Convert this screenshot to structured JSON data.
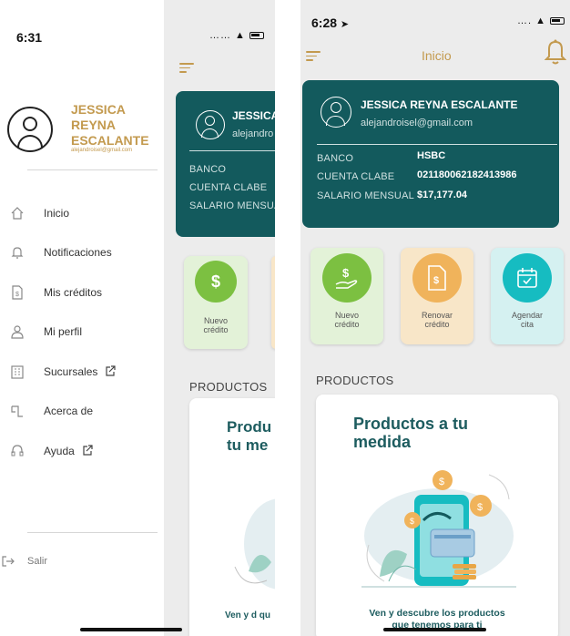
{
  "left": {
    "status": {
      "time": "6:31",
      "icons": "……"
    },
    "drawer": {
      "user_name": "JESSICA REYNA ESCALANTE",
      "user_email": "alejandroisel@gmail.com",
      "menu": [
        {
          "label": "Inicio",
          "icon": "home-icon"
        },
        {
          "label": "Notificaciones",
          "icon": "bell-icon"
        },
        {
          "label": "Mis créditos",
          "icon": "document-icon"
        },
        {
          "label": "Mi perfil",
          "icon": "person-icon"
        },
        {
          "label": "Sucursales",
          "icon": "building-icon"
        },
        {
          "label": "Acerca de",
          "icon": "info-card-icon"
        },
        {
          "label": "Ayuda",
          "icon": "headset-icon"
        }
      ],
      "logout": "Salir"
    },
    "behind": {
      "card_name": "JESSICA",
      "card_email": "alejandro",
      "rows": [
        "BANCO",
        "CUENTA CLABE",
        "SALARIO MENSUA"
      ],
      "action_label": "Nuevo crédito",
      "section": "PRODUCTOS",
      "promo_title": "Produ tu me",
      "promo_sub": "Ven y d qu"
    }
  },
  "right": {
    "status": {
      "time": "6:28"
    },
    "header": {
      "title": "Inicio"
    },
    "card": {
      "name": "JESSICA  REYNA ESCALANTE",
      "email": "alejandroisel@gmail.com",
      "rows": [
        {
          "label": "BANCO",
          "value": "HSBC"
        },
        {
          "label": "CUENTA CLABE",
          "value": "021180062182413986"
        },
        {
          "label": "SALARIO MENSUAL",
          "value": "$17,177.04"
        }
      ]
    },
    "actions": [
      {
        "label": "Nuevo crédito",
        "icon": "money-hand-icon",
        "bg": "#e3f2d8",
        "circle": "#7cc041"
      },
      {
        "label": "Renovar crédito",
        "icon": "document-money-icon",
        "bg": "#f8e6c8",
        "circle": "#f0b35b"
      },
      {
        "label": "Agendar cita",
        "icon": "calendar-icon",
        "bg": "#d5f1f1",
        "circle": "#16bcc1"
      }
    ],
    "section": "PRODUCTOS",
    "promo": {
      "title": "Productos a tu medida",
      "subtitle": "Ven y descubre los productos que tenemos para ti"
    }
  },
  "colors": {
    "accent_gold": "#c39a4f",
    "card_teal": "#135a5d"
  }
}
